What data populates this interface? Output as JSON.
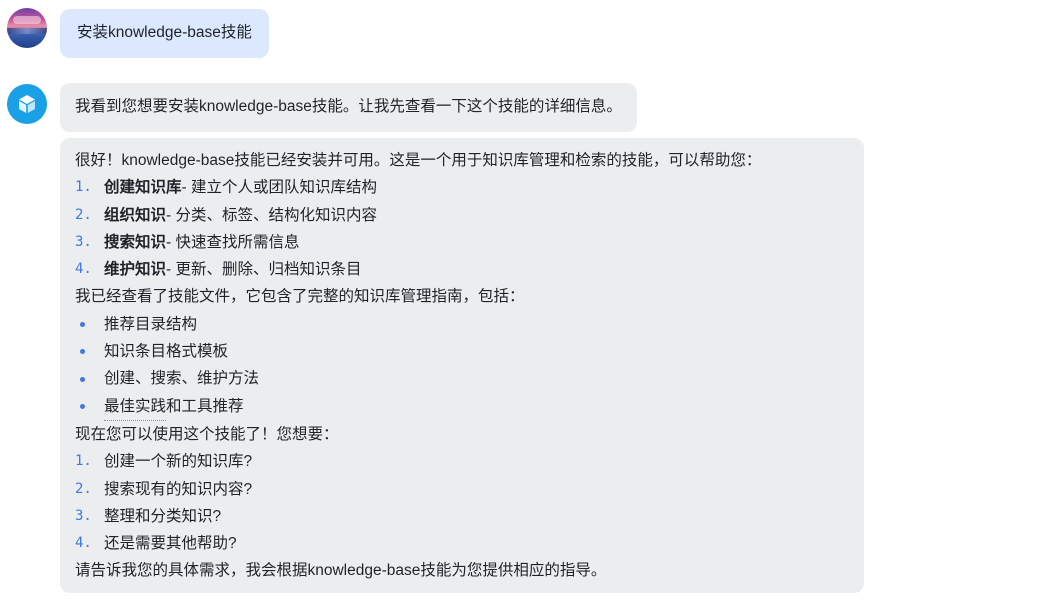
{
  "user_message": {
    "text": "安装knowledge-base技能"
  },
  "assistant_messages": {
    "first": "我看到您想要安装knowledge-base技能。让我先查看一下这个技能的详细信息。",
    "second": {
      "intro": "很好！knowledge-base技能已经安装并可用。这是一个用于知识库管理和检索的技能，可以帮助您：",
      "features": [
        {
          "num": "1.",
          "title": "创建知识库",
          "desc": " - 建立个人或团队知识库结构"
        },
        {
          "num": "2.",
          "title": "组织知识",
          "desc": " - 分类、标签、结构化知识内容"
        },
        {
          "num": "3.",
          "title": "搜索知识",
          "desc": " - 快速查找所需信息"
        },
        {
          "num": "4.",
          "title": "维护知识",
          "desc": " - 更新、删除、归档知识条目"
        }
      ],
      "review_line": "我已经查看了技能文件，它包含了完整的知识库管理指南，包括：",
      "bullets": [
        {
          "text": "推荐目录结构"
        },
        {
          "text": "知识条目格式模板"
        },
        {
          "text": "创建、搜索、维护方法"
        },
        {
          "text_pre": "最佳实践",
          "text_post": "和工具推荐"
        }
      ],
      "now_line": "现在您可以使用这个技能了！您想要：",
      "options": [
        {
          "num": "1.",
          "text": "创建一个新的知识库?"
        },
        {
          "num": "2.",
          "text": "搜索现有的知识内容?"
        },
        {
          "num": "3.",
          "text": "整理和分类知识?"
        },
        {
          "num": "4.",
          "text": "还是需要其他帮助?"
        }
      ],
      "closing": "请告诉我您的具体需求，我会根据knowledge-base技能为您提供相应的指导。"
    }
  },
  "colors": {
    "user_bubble": "#dbe8fd",
    "assistant_bubble": "#ecedef",
    "list_accent": "#3f78e0",
    "bot_avatar": "#1aa0e6"
  },
  "icons": {
    "user_avatar": "user-avatar-landscape",
    "bot_avatar": "cube-icon"
  }
}
